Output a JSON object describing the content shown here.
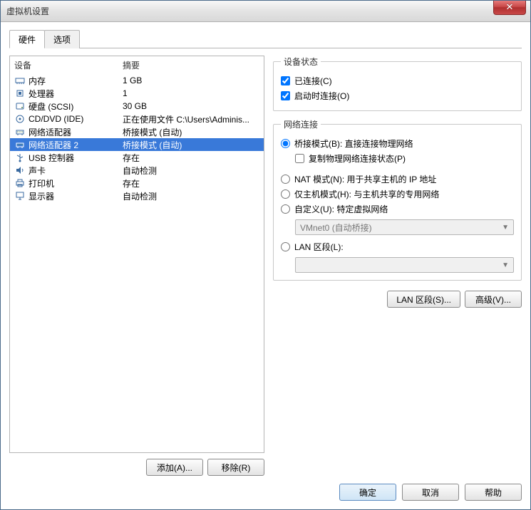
{
  "window": {
    "title": "虚拟机设置"
  },
  "tabs": {
    "hardware": "硬件",
    "options": "选项"
  },
  "list": {
    "col_device": "设备",
    "col_summary": "摘要",
    "rows": [
      {
        "icon": "memory-icon",
        "device": "内存",
        "summary": "1 GB"
      },
      {
        "icon": "cpu-icon",
        "device": "处理器",
        "summary": "1"
      },
      {
        "icon": "disk-icon",
        "device": "硬盘 (SCSI)",
        "summary": "30 GB"
      },
      {
        "icon": "cd-icon",
        "device": "CD/DVD (IDE)",
        "summary": "正在使用文件 C:\\Users\\Adminis..."
      },
      {
        "icon": "network-icon",
        "device": "网络适配器",
        "summary": "桥接模式 (自动)"
      },
      {
        "icon": "network-icon",
        "device": "网络适配器 2",
        "summary": "桥接模式 (自动)",
        "selected": true
      },
      {
        "icon": "usb-icon",
        "device": "USB 控制器",
        "summary": "存在"
      },
      {
        "icon": "sound-icon",
        "device": "声卡",
        "summary": "自动检测"
      },
      {
        "icon": "printer-icon",
        "device": "打印机",
        "summary": "存在"
      },
      {
        "icon": "display-icon",
        "device": "显示器",
        "summary": "自动检测"
      }
    ]
  },
  "left_buttons": {
    "add": "添加(A)...",
    "remove": "移除(R)"
  },
  "status": {
    "legend": "设备状态",
    "connected": "已连接(C)",
    "connect_at_poweron": "启动时连接(O)"
  },
  "network": {
    "legend": "网络连接",
    "bridged": "桥接模式(B): 直接连接物理网络",
    "replicate": "复制物理网络连接状态(P)",
    "nat": "NAT 模式(N): 用于共享主机的 IP 地址",
    "hostonly": "仅主机模式(H): 与主机共享的专用网络",
    "custom": "自定义(U): 特定虚拟网络",
    "custom_select": "VMnet0 (自动桥接)",
    "lan": "LAN 区段(L):",
    "lan_select": ""
  },
  "right_buttons": {
    "lan_segments": "LAN 区段(S)...",
    "advanced": "高级(V)..."
  },
  "footer": {
    "ok": "确定",
    "cancel": "取消",
    "help": "帮助"
  }
}
